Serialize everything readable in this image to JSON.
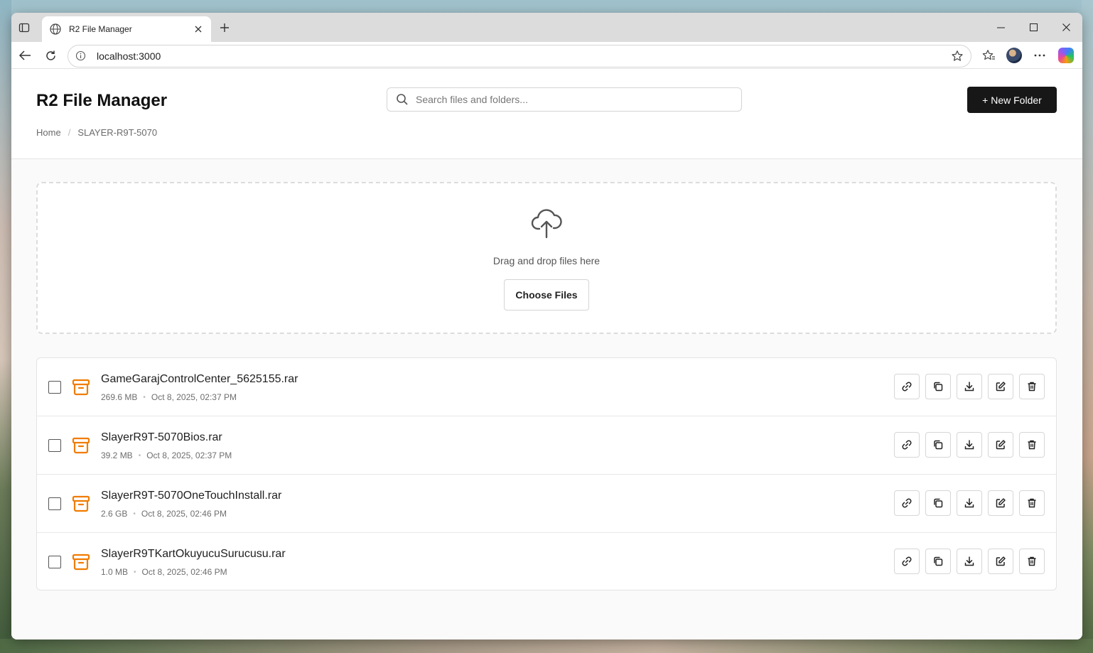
{
  "browser": {
    "tab_title": "R2 File Manager",
    "url": "localhost:3000"
  },
  "app": {
    "title": "R2 File Manager",
    "search_placeholder": "Search files and folders...",
    "new_folder_label": "+ New Folder",
    "breadcrumb": [
      "Home",
      "SLAYER-R9T-5070"
    ]
  },
  "upload": {
    "drop_text": "Drag and drop files here",
    "choose_label": "Choose Files"
  },
  "files": [
    {
      "name": "GameGarajControlCenter_5625155.rar",
      "size": "269.6 MB",
      "date": "Oct 8, 2025, 02:37 PM"
    },
    {
      "name": "SlayerR9T-5070Bios.rar",
      "size": "39.2 MB",
      "date": "Oct 8, 2025, 02:37 PM"
    },
    {
      "name": "SlayerR9T-5070OneTouchInstall.rar",
      "size": "2.6 GB",
      "date": "Oct 8, 2025, 02:46 PM"
    },
    {
      "name": "SlayerR9TKartOkuyucuSurucusu.rar",
      "size": "1.0 MB",
      "date": "Oct 8, 2025, 02:46 PM"
    }
  ],
  "meta_separator": "•",
  "colors": {
    "accent_archive": "#f07c00",
    "primary_button": "#171717"
  },
  "icons": {
    "file_actions": [
      "link-icon",
      "copy-icon",
      "download-icon",
      "edit-icon",
      "trash-icon"
    ]
  }
}
